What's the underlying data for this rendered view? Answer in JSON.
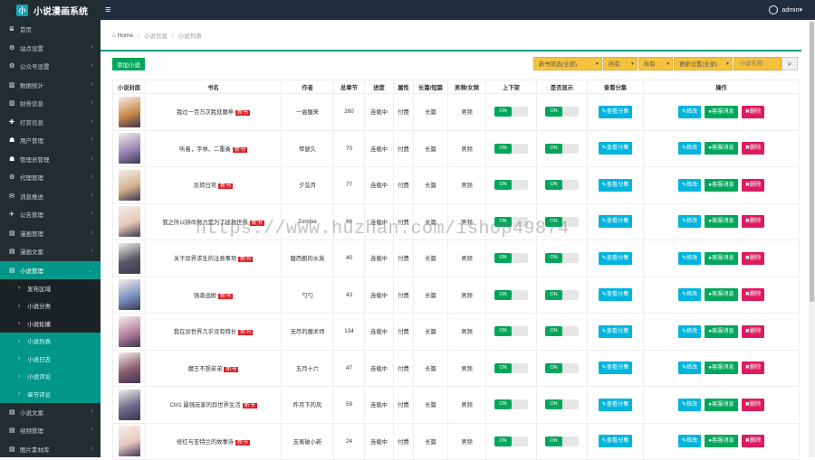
{
  "app": {
    "title": "小说漫画系统",
    "logo_glyph": "小",
    "menu_icon": "menu-icon"
  },
  "user": {
    "name": "admin"
  },
  "sidebar": {
    "items": [
      {
        "label": "首页",
        "icon": "≣"
      },
      {
        "label": "站点设置",
        "icon": "⚙"
      },
      {
        "label": "公众号设置",
        "icon": "⚙"
      },
      {
        "label": "数据统计",
        "icon": "▥"
      },
      {
        "label": "财务信息",
        "icon": "▥"
      },
      {
        "label": "打赏信息",
        "icon": "✚"
      },
      {
        "label": "用户管理",
        "icon": "☗"
      },
      {
        "label": "管理员管理",
        "icon": "☗"
      },
      {
        "label": "代理管理",
        "icon": "⚙"
      },
      {
        "label": "消息推送",
        "icon": "✉"
      },
      {
        "label": "公告管理",
        "icon": "✈"
      },
      {
        "label": "漫画管理",
        "icon": "▤"
      },
      {
        "label": "漫画文案",
        "icon": "▤"
      },
      {
        "label": "小说管理",
        "icon": "▤"
      }
    ],
    "subitems": [
      {
        "label": "发布区域"
      },
      {
        "label": "小说分类"
      },
      {
        "label": "小说轮播"
      },
      {
        "label": "小说列表"
      },
      {
        "label": "小说日志"
      },
      {
        "label": "小说评论"
      },
      {
        "label": "章节评论"
      }
    ],
    "bottom": [
      {
        "label": "小说文案",
        "icon": "▤"
      },
      {
        "label": "视频管理",
        "icon": "▤"
      },
      {
        "label": "图片素材库",
        "icon": "▤"
      }
    ]
  },
  "breadcrumb": {
    "home": "Home",
    "level1": "小说信息",
    "level2": "小说列表"
  },
  "toolbar": {
    "add_label": "添加小说",
    "filters": [
      "新书筛选(全部)",
      "所有",
      "所有",
      "更新设置(全部)"
    ],
    "search_placeholder": "小说名称"
  },
  "table": {
    "headers": [
      "小说封面",
      "书名",
      "作者",
      "总章节",
      "进度",
      "属性",
      "长篇/短篇",
      "男频/女频",
      "上下架",
      "是否显示",
      "查看分集",
      "操作"
    ],
    "new_badge": "新书",
    "on_label": "ON",
    "view_label": "查看分集",
    "edit_label": "修改",
    "msg_label": "客服消息",
    "del_label": "删除",
    "rows": [
      {
        "title": "我过一百万次我就魔神",
        "author": "一尝醒来",
        "chapters": "260",
        "progress": "连载中",
        "attr": "付费",
        "length": "长篇",
        "gender": "男频",
        "cover": "#c98a4b"
      },
      {
        "title": "听着，字林、二重奏",
        "author": "琴瑟久",
        "chapters": "70",
        "progress": "连载中",
        "attr": "付费",
        "length": "长篇",
        "gender": "男频",
        "cover": "#9c86b8"
      },
      {
        "title": "反转日常",
        "author": "夕弦月",
        "chapters": "77",
        "progress": "连载中",
        "attr": "付费",
        "length": "长篇",
        "gender": "男频",
        "cover": "#d3b38c"
      },
      {
        "title": "我之所以拼命努力是为了拯救世界",
        "author": "Zombie",
        "chapters": "66",
        "progress": "连载中",
        "attr": "付费",
        "length": "长篇",
        "gender": "男频",
        "cover": "#e6c7b6"
      },
      {
        "title": "关于异界求生的注意事项",
        "author": "腹西鲍的水族",
        "chapters": "40",
        "progress": "连载中",
        "attr": "付费",
        "length": "长篇",
        "gender": "男频",
        "cover": "#5a5866"
      },
      {
        "title": "强袭战姬",
        "author": "勺勺",
        "chapters": "43",
        "progress": "连载中",
        "attr": "付费",
        "length": "长篇",
        "gender": "男频",
        "cover": "#7e93c4"
      },
      {
        "title": "我在异世界几乎没有特长",
        "author": "无尽的魔术师",
        "chapters": "134",
        "progress": "连载中",
        "attr": "付费",
        "length": "长篇",
        "gender": "男频",
        "cover": "#b7809d"
      },
      {
        "title": "魔王不想弟弟",
        "author": "五月十六",
        "chapters": "47",
        "progress": "连载中",
        "attr": "付费",
        "length": "长篇",
        "gender": "男频",
        "cover": "#8c5c6e"
      },
      {
        "title": "Ctrl1 最强玩家的异世界生活",
        "author": "昨月下的风",
        "chapters": "59",
        "progress": "连载中",
        "attr": "付费",
        "length": "长篇",
        "gender": "男频",
        "cover": "#6d6a8a"
      },
      {
        "title": "修红与亚特兰的故事诗",
        "author": "支离破小新",
        "chapters": "24",
        "progress": "连载中",
        "attr": "付费",
        "length": "长篇",
        "gender": "男频",
        "cover": "#e8c8c0"
      }
    ]
  },
  "watermark": "https://www.huzhan.com/ishop49874"
}
